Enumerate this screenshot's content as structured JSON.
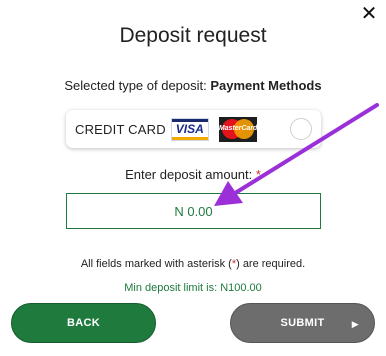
{
  "dialog": {
    "title": "Deposit request",
    "selected_prefix": "Selected type of deposit: ",
    "selected_value": "Payment Methods"
  },
  "payment_method": {
    "label": "CREDIT CARD",
    "visa_text": "VISA",
    "mastercard_text": "MasterCard"
  },
  "amount": {
    "label": "Enter deposit amount: ",
    "required_mark": "*",
    "value": "N 0.00"
  },
  "notes": {
    "fields_prefix": "All fields marked with asterisk (",
    "fields_mark": "*",
    "fields_suffix": ") are required.",
    "min_limit": "Min deposit limit is: N100.00"
  },
  "buttons": {
    "back": "BACK",
    "submit": "SUBMIT"
  },
  "icons": {
    "close": "close-icon",
    "submit_arrow": "chevron-right-icon"
  },
  "colors": {
    "accent_green": "#1f7a3e",
    "submit_gray": "#6d6d6d",
    "required_red": "#d32f2f",
    "annotation_purple": "#9b30d9"
  }
}
